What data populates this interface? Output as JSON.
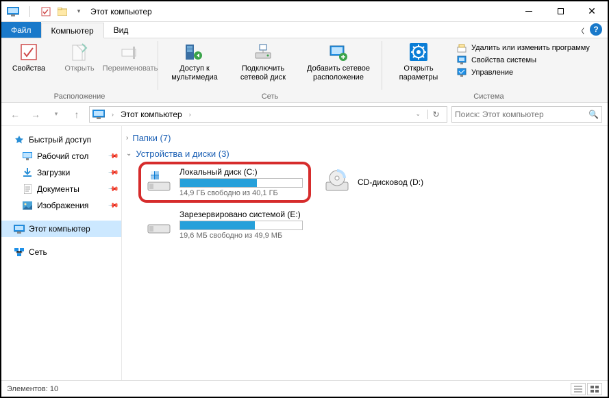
{
  "window": {
    "title": "Этот компьютер"
  },
  "tabs": {
    "file": "Файл",
    "computer": "Компьютер",
    "view": "Вид"
  },
  "ribbon": {
    "properties": "Свойства",
    "open": "Открыть",
    "rename": "Переименовать",
    "location_caption": "Расположение",
    "media_access": "Доступ к\nмультимедиа",
    "map_drive": "Подключить\nсетевой диск",
    "add_network": "Добавить сетевое\nрасположение",
    "network_caption": "Сеть",
    "open_settings": "Открыть\nпараметры",
    "uninstall": "Удалить или изменить программу",
    "sys_props": "Свойства системы",
    "manage": "Управление",
    "system_caption": "Система"
  },
  "address": {
    "location": "Этот компьютер"
  },
  "search": {
    "placeholder": "Поиск: Этот компьютер"
  },
  "sidebar": {
    "quick": "Быстрый доступ",
    "desktop": "Рабочий стол",
    "downloads": "Загрузки",
    "documents": "Документы",
    "pictures": "Изображения",
    "thispc": "Этот компьютер",
    "network": "Сеть"
  },
  "categories": {
    "folders": "Папки (7)",
    "devices": "Устройства и диски (3)"
  },
  "drives": {
    "c": {
      "name": "Локальный диск (C:)",
      "free": "14,9 ГБ свободно из 40,1 ГБ",
      "fill": 63
    },
    "d": {
      "name": "CD-дисковод (D:)"
    },
    "e": {
      "name": "Зарезервировано системой (E:)",
      "free": "19,6 МБ свободно из 49,9 МБ",
      "fill": 61
    }
  },
  "status": {
    "items": "Элементов: 10"
  }
}
